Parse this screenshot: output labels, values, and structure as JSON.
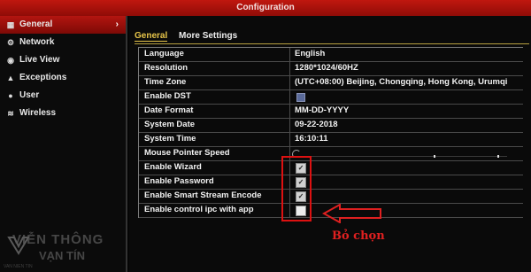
{
  "window": {
    "title": "Configuration"
  },
  "sidebar": {
    "items": [
      {
        "label": "General",
        "icon": "general-icon",
        "active": true
      },
      {
        "label": "Network",
        "icon": "network-icon"
      },
      {
        "label": "Live View",
        "icon": "live-view-icon"
      },
      {
        "label": "Exceptions",
        "icon": "warning-icon"
      },
      {
        "label": "User",
        "icon": "user-icon"
      },
      {
        "label": "Wireless",
        "icon": "wireless-icon"
      }
    ]
  },
  "tabs": [
    {
      "label": "General",
      "active": true
    },
    {
      "label": "More Settings"
    }
  ],
  "settings": [
    {
      "label": "Language",
      "value": "English"
    },
    {
      "label": "Resolution",
      "value": "1280*1024/60HZ"
    },
    {
      "label": "Time Zone",
      "value": "(UTC+08:00) Beijing, Chongqing, Hong Kong, Urumqi"
    },
    {
      "label": "Enable DST",
      "value": ""
    },
    {
      "label": "Date Format",
      "value": "MM-DD-YYYY"
    },
    {
      "label": "System Date",
      "value": "09-22-2018"
    },
    {
      "label": "System Time",
      "value": "16:10:11"
    },
    {
      "label": "Mouse Pointer Speed",
      "value": ""
    },
    {
      "label": "Enable Wizard",
      "checked": true
    },
    {
      "label": "Enable Password",
      "checked": true
    },
    {
      "label": "Enable Smart Stream Encode",
      "checked": true
    },
    {
      "label": "Enable control ipc with app",
      "checked": false
    }
  ],
  "annotation": {
    "text": "Bỏ chọn",
    "color": "#e02020"
  },
  "watermark": {
    "line1": "VIỄN THÔNG",
    "line2": "VẠN TÍN",
    "line3": "VAN NIEN TIN"
  },
  "colors": {
    "titlebar": "#b3140e",
    "accent_tab": "#e8c64a",
    "active_sidebar": "#b31510"
  }
}
